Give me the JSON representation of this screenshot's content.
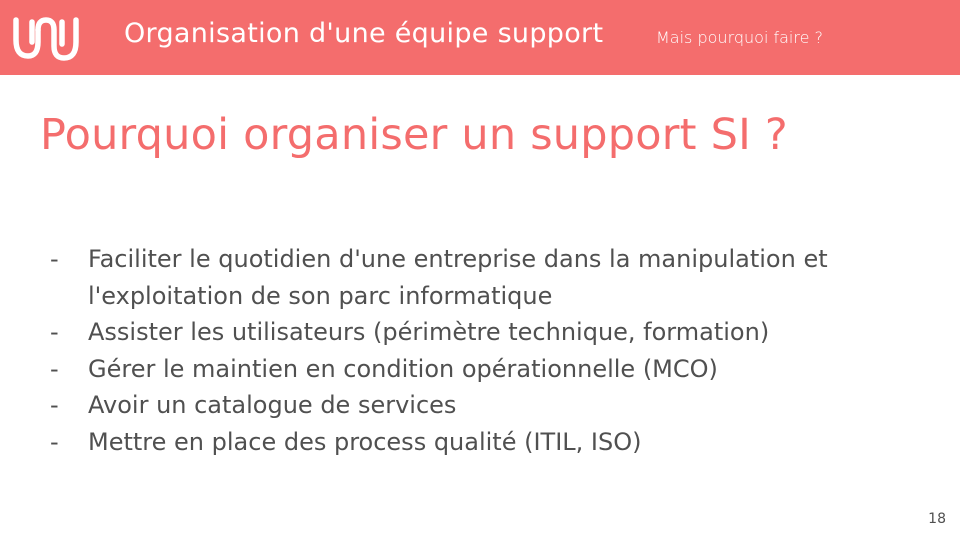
{
  "header": {
    "title": "Organisation d'une équipe support",
    "subtitle": "Mais pourquoi faire ?",
    "logo_icon": "wave-logo-icon",
    "background_color": "#f46d6d",
    "text_color": "#ffffff"
  },
  "slide": {
    "title": "Pourquoi organiser un support SI ?",
    "title_color": "#f46d6d",
    "bullet_marker": "-",
    "bullets": [
      "Faciliter le quotidien d'une entreprise dans la manipulation et l'exploitation de son parc informatique",
      "Assister les utilisateurs (périmètre technique, formation)",
      "Gérer le maintien en condition opérationnelle (MCO)",
      "Avoir un catalogue de services",
      "Mettre en place des process qualité (ITIL, ISO)"
    ],
    "page_number": "18"
  }
}
